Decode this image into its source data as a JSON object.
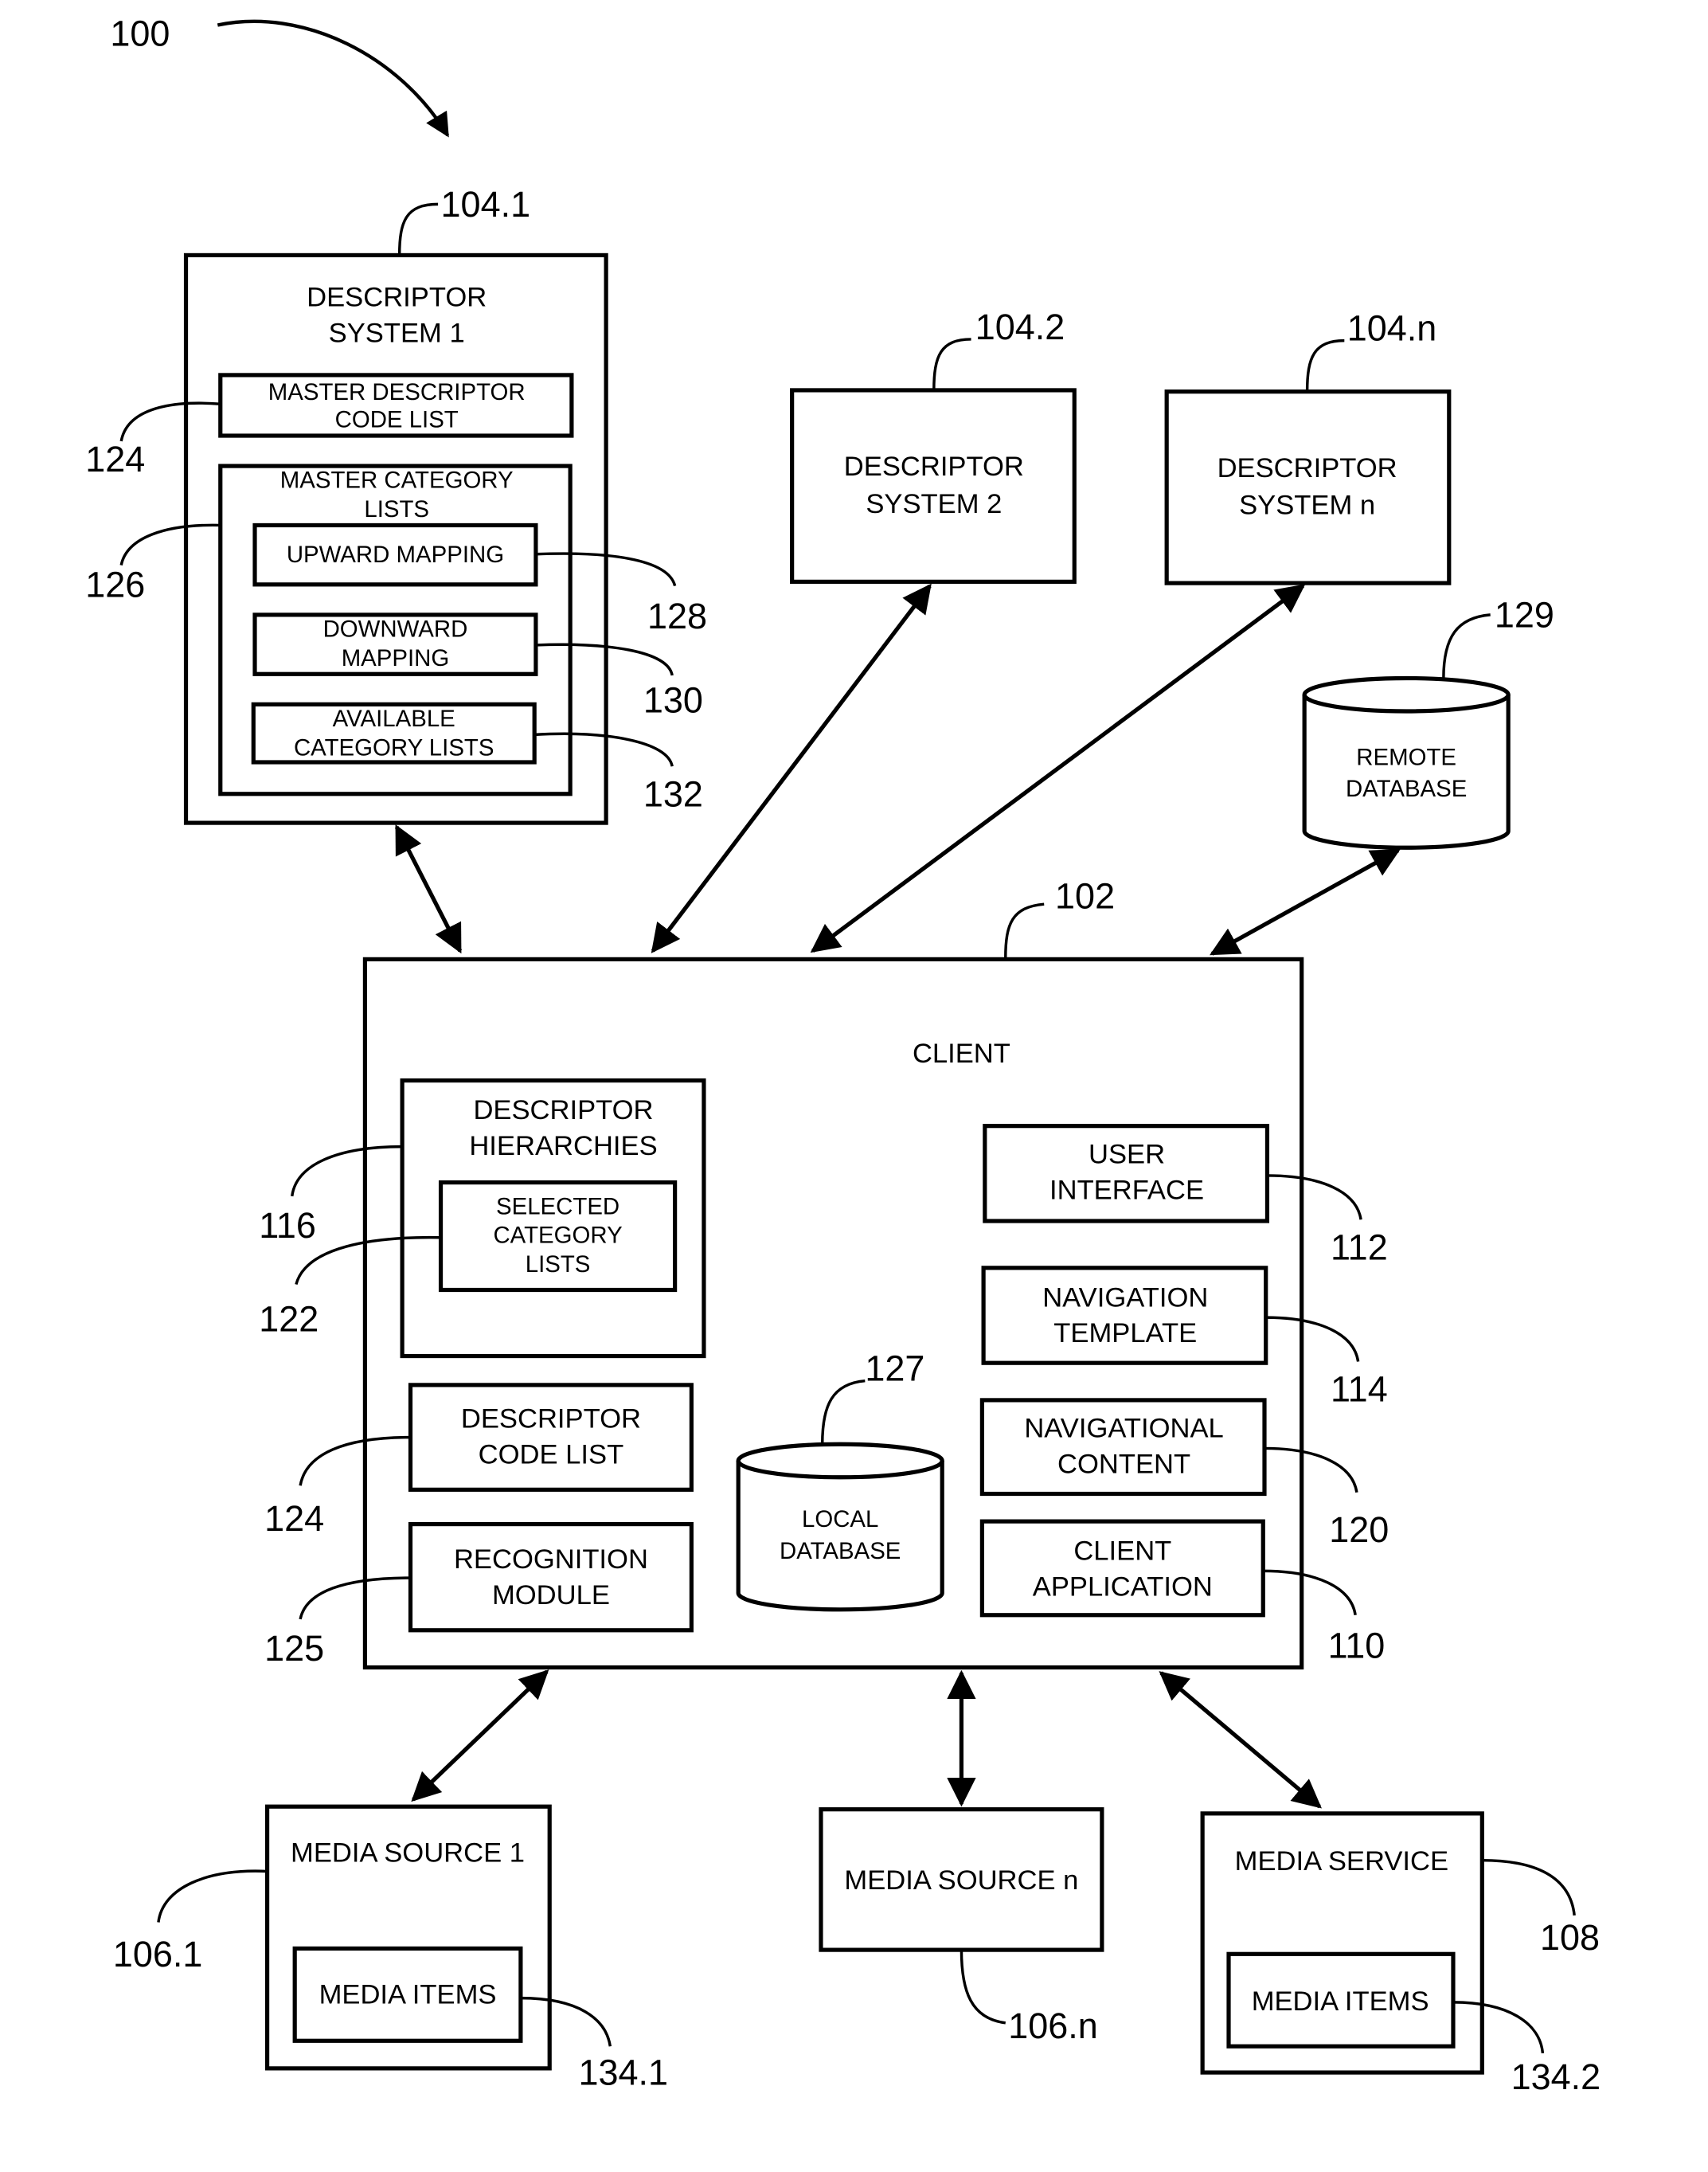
{
  "figure": {
    "ref": "100"
  },
  "descriptor_system_1": {
    "ref": "104.1",
    "title_lines": [
      "DESCRIPTOR",
      "SYSTEM 1"
    ],
    "master_code_list": {
      "ref": "124",
      "lines": [
        "MASTER DESCRIPTOR",
        "CODE LIST"
      ]
    },
    "master_category_lists": {
      "ref": "126",
      "lines": [
        "MASTER CATEGORY",
        "LISTS"
      ],
      "upward_mapping": {
        "ref": "128",
        "lines": [
          "UPWARD MAPPING"
        ]
      },
      "downward_mapping": {
        "ref": "130",
        "lines": [
          "DOWNWARD",
          "MAPPING"
        ]
      },
      "available_category_lists": {
        "ref": "132",
        "lines": [
          "AVAILABLE",
          "CATEGORY LISTS"
        ]
      }
    }
  },
  "descriptor_system_2": {
    "ref": "104.2",
    "lines": [
      "DESCRIPTOR",
      "SYSTEM 2"
    ]
  },
  "descriptor_system_n": {
    "ref": "104.n",
    "lines": [
      "DESCRIPTOR",
      "SYSTEM n"
    ]
  },
  "remote_database": {
    "ref": "129",
    "lines": [
      "REMOTE",
      "DATABASE"
    ]
  },
  "client": {
    "ref": "102",
    "title": "CLIENT",
    "descriptor_hierarchies": {
      "ref": "116",
      "lines": [
        "DESCRIPTOR",
        "HIERARCHIES"
      ],
      "selected_category_lists": {
        "ref": "122",
        "lines": [
          "SELECTED",
          "CATEGORY",
          "LISTS"
        ]
      }
    },
    "descriptor_code_list": {
      "ref": "124",
      "lines": [
        "DESCRIPTOR",
        "CODE LIST"
      ]
    },
    "recognition_module": {
      "ref": "125",
      "lines": [
        "RECOGNITION",
        "MODULE"
      ]
    },
    "local_database": {
      "ref": "127",
      "lines": [
        "LOCAL",
        "DATABASE"
      ]
    },
    "user_interface": {
      "ref": "112",
      "lines": [
        "USER",
        "INTERFACE"
      ]
    },
    "navigation_template": {
      "ref": "114",
      "lines": [
        "NAVIGATION",
        "TEMPLATE"
      ]
    },
    "navigational_content": {
      "ref": "120",
      "lines": [
        "NAVIGATIONAL",
        "CONTENT"
      ]
    },
    "client_application": {
      "ref": "110",
      "lines": [
        "CLIENT",
        "APPLICATION"
      ]
    }
  },
  "media_source_1": {
    "ref": "106.1",
    "title": "MEDIA SOURCE 1",
    "media_items": {
      "ref": "134.1",
      "label": "MEDIA ITEMS"
    }
  },
  "media_source_n": {
    "ref": "106.n",
    "title": "MEDIA SOURCE n"
  },
  "media_service": {
    "ref": "108",
    "title": "MEDIA SERVICE",
    "media_items": {
      "ref": "134.2",
      "label": "MEDIA ITEMS"
    }
  }
}
